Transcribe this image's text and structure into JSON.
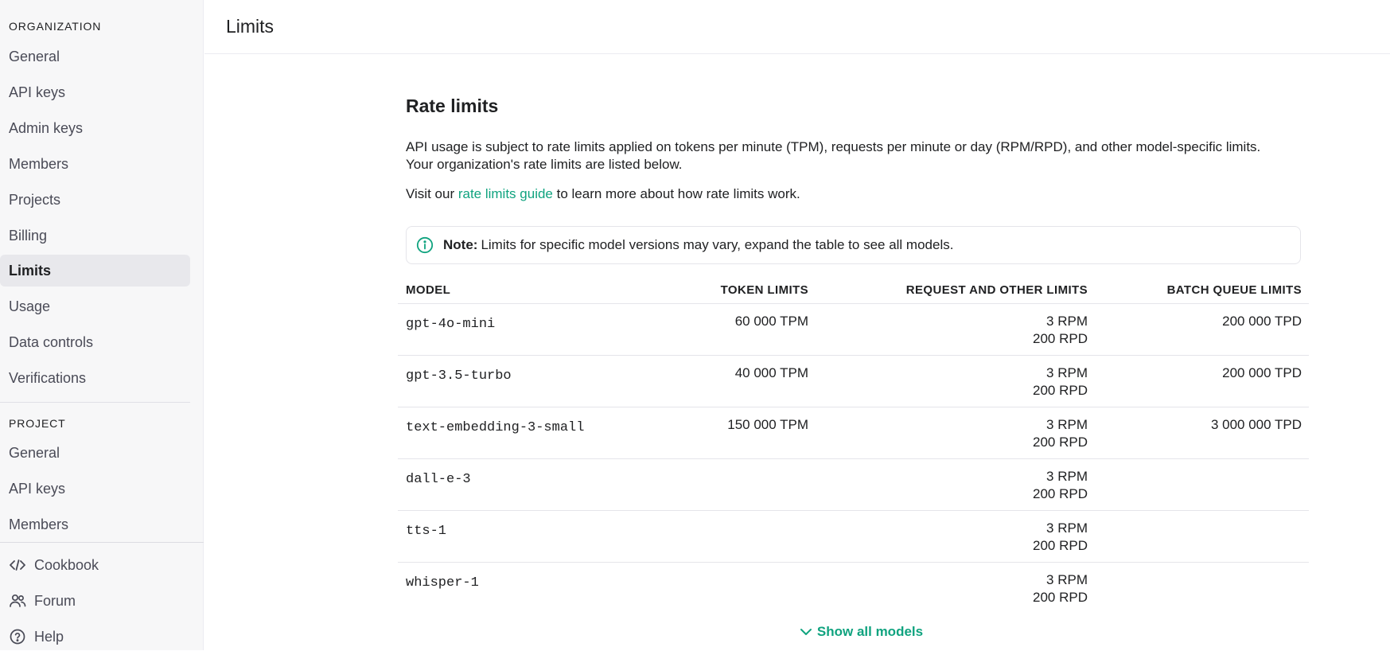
{
  "sidebar": {
    "org_title": "ORGANIZATION",
    "org_items": [
      {
        "label": "General"
      },
      {
        "label": "API keys"
      },
      {
        "label": "Admin keys"
      },
      {
        "label": "Members"
      },
      {
        "label": "Projects"
      },
      {
        "label": "Billing"
      },
      {
        "label": "Limits",
        "active": true
      },
      {
        "label": "Usage"
      },
      {
        "label": "Data controls"
      },
      {
        "label": "Verifications"
      }
    ],
    "project_title": "PROJECT",
    "project_items": [
      {
        "label": "General"
      },
      {
        "label": "API keys"
      },
      {
        "label": "Members"
      }
    ],
    "footer": [
      {
        "label": "Cookbook",
        "icon": "code-icon"
      },
      {
        "label": "Forum",
        "icon": "people-icon"
      },
      {
        "label": "Help",
        "icon": "help-circle-icon"
      }
    ]
  },
  "header": {
    "title": "Limits"
  },
  "main": {
    "heading": "Rate limits",
    "description_line1": "API usage is subject to rate limits applied on tokens per minute (TPM), requests per minute or day (RPM/RPD), and other model-specific limits.",
    "description_line2": "Your organization's rate limits are listed below.",
    "visit_prefix": "Visit our ",
    "visit_link": "rate limits guide",
    "visit_suffix": " to learn more about how rate limits work.",
    "note_bold": "Note:",
    "note_text": "Limits for specific model versions may vary, expand the table to see all models.",
    "accent_color": "#10a37f"
  },
  "table": {
    "headers": {
      "model": "MODEL",
      "token": "TOKEN LIMITS",
      "request": "REQUEST AND OTHER LIMITS",
      "batch": "BATCH QUEUE LIMITS"
    },
    "rows": [
      {
        "model": "gpt-4o-mini",
        "token": "60 000 TPM",
        "rpm": "3 RPM",
        "rpd": "200 RPD",
        "batch": "200 000 TPD"
      },
      {
        "model": "gpt-3.5-turbo",
        "token": "40 000 TPM",
        "rpm": "3 RPM",
        "rpd": "200 RPD",
        "batch": "200 000 TPD"
      },
      {
        "model": "text-embedding-3-small",
        "token": "150 000 TPM",
        "rpm": "3 RPM",
        "rpd": "200 RPD",
        "batch": "3 000 000 TPD"
      },
      {
        "model": "dall-e-3",
        "token": "",
        "rpm": "3 RPM",
        "rpd": "200 RPD",
        "batch": ""
      },
      {
        "model": "tts-1",
        "token": "",
        "rpm": "3 RPM",
        "rpd": "200 RPD",
        "batch": ""
      },
      {
        "model": "whisper-1",
        "token": "",
        "rpm": "3 RPM",
        "rpd": "200 RPD",
        "batch": ""
      }
    ],
    "show_all_label": "Show all models"
  }
}
